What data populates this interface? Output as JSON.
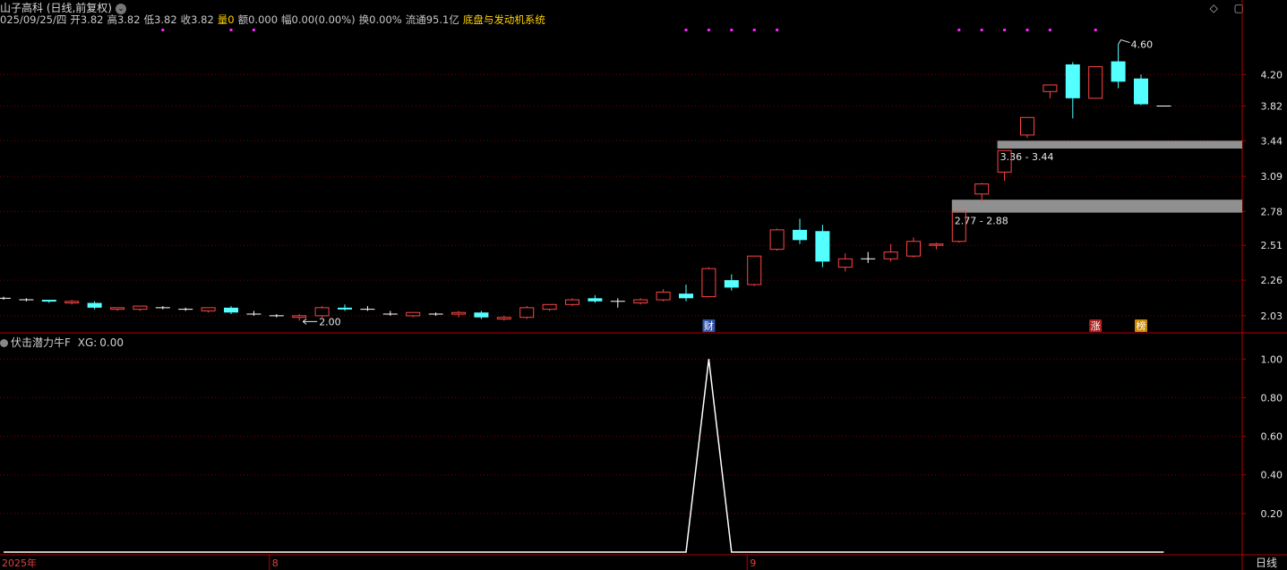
{
  "header": {
    "stock_title": "山子高科 (日线,前复权)",
    "quote": {
      "date": "025/09/25/四",
      "open_label": "开",
      "open": "3.82",
      "high_label": "高",
      "high": "3.82",
      "low_label": "低",
      "low": "3.82",
      "close_label": "收",
      "close": "3.82",
      "volume_label": "量",
      "volume": "0",
      "amount_label": "额",
      "amount": "0.000",
      "change_label": "幅",
      "change": "0.00(0.00%)",
      "turnover_label": "换",
      "turnover": "0.00%",
      "float_label": "流通",
      "float": "95.1亿"
    },
    "system_name": "底盘与发动机系统",
    "controls": [
      "◇",
      "▢"
    ]
  },
  "indicator": {
    "label": "伏击潜力牛F",
    "xg_label": "XG:",
    "xg_value": "0.00"
  },
  "period_label": "日线",
  "chart_data": [
    {
      "type": "candlestick",
      "y_ticks": [
        4.2,
        3.82,
        3.44,
        3.09,
        2.78,
        2.51,
        2.26,
        2.03
      ],
      "y_tick_labels": [
        "4.20",
        "3.82",
        "3.44",
        "3.09",
        "2.78",
        "2.51",
        "2.26",
        "2.03"
      ],
      "x_tick_labels": [
        "2025年",
        "8",
        "9"
      ],
      "x_tick_index": [
        0,
        12,
        33
      ],
      "candles": [
        {
          "o": 2.14,
          "h": 2.15,
          "l": 2.13,
          "c": 2.14,
          "dir": "flat"
        },
        {
          "o": 2.13,
          "h": 2.14,
          "l": 2.12,
          "c": 2.13,
          "dir": "flat"
        },
        {
          "o": 2.13,
          "h": 2.13,
          "l": 2.11,
          "c": 2.12,
          "dir": "down"
        },
        {
          "o": 2.11,
          "h": 2.13,
          "l": 2.1,
          "c": 2.12,
          "dir": "up"
        },
        {
          "o": 2.11,
          "h": 2.12,
          "l": 2.07,
          "c": 2.08,
          "dir": "down"
        },
        {
          "o": 2.07,
          "h": 2.08,
          "l": 2.06,
          "c": 2.08,
          "dir": "up"
        },
        {
          "o": 2.07,
          "h": 2.09,
          "l": 2.06,
          "c": 2.09,
          "dir": "up"
        },
        {
          "o": 2.08,
          "h": 2.09,
          "l": 2.07,
          "c": 2.08,
          "dir": "flat"
        },
        {
          "o": 2.07,
          "h": 2.08,
          "l": 2.06,
          "c": 2.07,
          "dir": "flat"
        },
        {
          "o": 2.06,
          "h": 2.08,
          "l": 2.05,
          "c": 2.08,
          "dir": "up"
        },
        {
          "o": 2.08,
          "h": 2.09,
          "l": 2.04,
          "c": 2.05,
          "dir": "down"
        },
        {
          "o": 2.05,
          "h": 2.06,
          "l": 2.03,
          "c": 2.04,
          "dir": "flat"
        },
        {
          "o": 2.03,
          "h": 2.04,
          "l": 2.02,
          "c": 2.03,
          "dir": "flat"
        },
        {
          "o": 2.02,
          "h": 2.04,
          "l": 2.0,
          "c": 2.03,
          "dir": "up"
        },
        {
          "o": 2.03,
          "h": 2.09,
          "l": 2.02,
          "c": 2.08,
          "dir": "up"
        },
        {
          "o": 2.08,
          "h": 2.1,
          "l": 2.06,
          "c": 2.07,
          "dir": "down"
        },
        {
          "o": 2.08,
          "h": 2.09,
          "l": 2.06,
          "c": 2.07,
          "dir": "flat"
        },
        {
          "o": 2.05,
          "h": 2.06,
          "l": 2.03,
          "c": 2.04,
          "dir": "flat"
        },
        {
          "o": 2.03,
          "h": 2.05,
          "l": 2.02,
          "c": 2.05,
          "dir": "up"
        },
        {
          "o": 2.04,
          "h": 2.05,
          "l": 2.03,
          "c": 2.04,
          "dir": "flat"
        },
        {
          "o": 2.04,
          "h": 2.06,
          "l": 2.02,
          "c": 2.05,
          "dir": "up"
        },
        {
          "o": 2.05,
          "h": 2.06,
          "l": 2.01,
          "c": 2.02,
          "dir": "down"
        },
        {
          "o": 2.01,
          "h": 2.03,
          "l": 2.0,
          "c": 2.02,
          "dir": "up"
        },
        {
          "o": 2.02,
          "h": 2.09,
          "l": 2.01,
          "c": 2.08,
          "dir": "up"
        },
        {
          "o": 2.07,
          "h": 2.1,
          "l": 2.06,
          "c": 2.1,
          "dir": "up"
        },
        {
          "o": 2.1,
          "h": 2.14,
          "l": 2.09,
          "c": 2.13,
          "dir": "up"
        },
        {
          "o": 2.14,
          "h": 2.16,
          "l": 2.11,
          "c": 2.12,
          "dir": "down"
        },
        {
          "o": 2.12,
          "h": 2.14,
          "l": 2.08,
          "c": 2.12,
          "dir": "flat"
        },
        {
          "o": 2.11,
          "h": 2.14,
          "l": 2.1,
          "c": 2.13,
          "dir": "up"
        },
        {
          "o": 2.13,
          "h": 2.2,
          "l": 2.12,
          "c": 2.18,
          "dir": "up"
        },
        {
          "o": 2.17,
          "h": 2.23,
          "l": 2.12,
          "c": 2.14,
          "dir": "down"
        },
        {
          "o": 2.15,
          "h": 2.35,
          "l": 2.15,
          "c": 2.34,
          "dir": "up"
        },
        {
          "o": 2.26,
          "h": 2.3,
          "l": 2.19,
          "c": 2.21,
          "dir": "down"
        },
        {
          "o": 2.23,
          "h": 2.43,
          "l": 2.22,
          "c": 2.43,
          "dir": "up"
        },
        {
          "o": 2.48,
          "h": 2.64,
          "l": 2.47,
          "c": 2.63,
          "dir": "up"
        },
        {
          "o": 2.63,
          "h": 2.72,
          "l": 2.52,
          "c": 2.55,
          "dir": "down"
        },
        {
          "o": 2.62,
          "h": 2.67,
          "l": 2.35,
          "c": 2.39,
          "dir": "down"
        },
        {
          "o": 2.35,
          "h": 2.45,
          "l": 2.32,
          "c": 2.41,
          "dir": "up"
        },
        {
          "o": 2.41,
          "h": 2.46,
          "l": 2.38,
          "c": 2.41,
          "dir": "flat"
        },
        {
          "o": 2.41,
          "h": 2.52,
          "l": 2.39,
          "c": 2.46,
          "dir": "up"
        },
        {
          "o": 2.43,
          "h": 2.57,
          "l": 2.42,
          "c": 2.54,
          "dir": "up"
        },
        {
          "o": 2.51,
          "h": 2.53,
          "l": 2.48,
          "c": 2.52,
          "dir": "up"
        },
        {
          "o": 2.54,
          "h": 2.78,
          "l": 2.53,
          "c": 2.78,
          "dir": "up"
        },
        {
          "o": 2.93,
          "h": 3.03,
          "l": 2.86,
          "c": 3.02,
          "dir": "up"
        },
        {
          "o": 3.13,
          "h": 3.34,
          "l": 3.05,
          "c": 3.34,
          "dir": "up"
        },
        {
          "o": 3.5,
          "h": 3.69,
          "l": 3.47,
          "c": 3.69,
          "dir": "up"
        },
        {
          "o": 3.99,
          "h": 4.07,
          "l": 3.91,
          "c": 4.07,
          "dir": "up"
        },
        {
          "o": 4.33,
          "h": 4.36,
          "l": 3.68,
          "c": 3.91,
          "dir": "down"
        },
        {
          "o": 3.91,
          "h": 4.3,
          "l": 3.91,
          "c": 4.3,
          "dir": "up"
        },
        {
          "o": 4.11,
          "h": 4.6,
          "l": 4.03,
          "c": 4.37,
          "dir": "down"
        },
        {
          "o": 4.15,
          "h": 4.2,
          "l": 3.83,
          "c": 3.84,
          "dir": "down"
        },
        {
          "o": 3.82,
          "h": 3.82,
          "l": 3.82,
          "c": 3.82,
          "dir": "flat"
        }
      ],
      "annotations": {
        "low_label": "2.00",
        "low_index": 13,
        "high_label": "4.60",
        "high_index": 49
      },
      "zones": [
        {
          "from": 3.36,
          "to": 3.44,
          "label": "3.36 - 3.44",
          "start_index": 44
        },
        {
          "from": 2.77,
          "to": 2.88,
          "label": "2.77 - 2.88",
          "start_index": 42
        }
      ],
      "markers": [
        {
          "index": 31,
          "text": "财",
          "bg": "#3355aa",
          "color": "#ffffff"
        },
        {
          "index": 48,
          "text": "涨",
          "bg": "#aa2222",
          "color": "#ffffff"
        },
        {
          "index": 50,
          "text": "榜",
          "bg": "#cc8800",
          "color": "#ffffff"
        }
      ],
      "top_dot_indices": [
        7,
        10,
        11,
        30,
        31,
        32,
        33,
        34,
        42,
        43,
        44,
        45,
        46,
        48
      ],
      "colors": {
        "up": "#ff4444",
        "down": "#54ffff",
        "flat": "#ffffff",
        "axis": "#b40000",
        "zone": "#909090",
        "dot": "#ff22ff"
      }
    },
    {
      "type": "line",
      "name": "XG",
      "ylim": [
        0,
        1.08
      ],
      "y_ticks": [
        1.0,
        0.8,
        0.6,
        0.4,
        0.2
      ],
      "y_tick_labels": [
        "1.00",
        "0.80",
        "0.60",
        "0.40",
        "0.20"
      ],
      "values": [
        0,
        0,
        0,
        0,
        0,
        0,
        0,
        0,
        0,
        0,
        0,
        0,
        0,
        0,
        0,
        0,
        0,
        0,
        0,
        0,
        0,
        0,
        0,
        0,
        0,
        0,
        0,
        0,
        0,
        0,
        0,
        1,
        0,
        0,
        0,
        0,
        0,
        0,
        0,
        0,
        0,
        0,
        0,
        0,
        0,
        0,
        0,
        0,
        0,
        0,
        0,
        0
      ],
      "color": "#ffffff"
    }
  ]
}
